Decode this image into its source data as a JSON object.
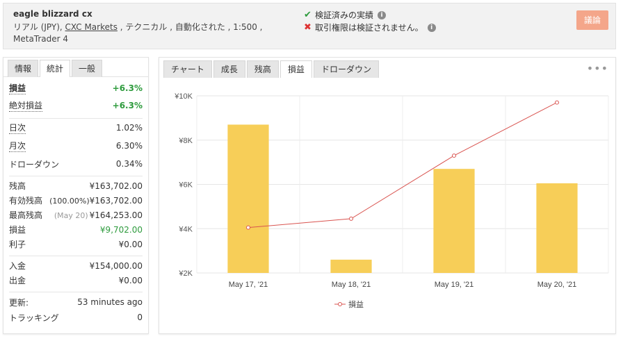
{
  "header": {
    "account_name": "eagle blizzard cx",
    "desc_prefix": "リアル (JPY), ",
    "broker": "CXC Markets",
    "desc_suffix": " , テクニカル , 自動化された , 1:500 , MetaTrader 4",
    "verified_label": "検証済みの実績",
    "trading_label": "取引権限は検証されません。",
    "discuss_button": "議論"
  },
  "left": {
    "tabs": [
      "情報",
      "統計",
      "一般"
    ],
    "active_tab": 1,
    "stats": {
      "gain_label": "損益",
      "gain_value": "+6.3%",
      "abs_gain_label": "絶対損益",
      "abs_gain_value": "+6.3%",
      "daily_label": "日次",
      "daily_value": "1.02%",
      "monthly_label": "月次",
      "monthly_value": "6.30%",
      "drawdown_label": "ドローダウン",
      "drawdown_value": "0.34%",
      "balance_label": "残高",
      "balance_value": "¥163,702.00",
      "equity_label": "有効残高",
      "equity_pct": "(100.00%)",
      "equity_value": "¥163,702.00",
      "highest_label": "最高残高",
      "highest_date": "(May 20)",
      "highest_value": "¥164,253.00",
      "profit_label": "損益",
      "profit_value": "¥9,702.00",
      "interest_label": "利子",
      "interest_value": "¥0.00",
      "deposits_label": "入金",
      "deposits_value": "¥154,000.00",
      "withdrawals_label": "出金",
      "withdrawals_value": "¥0.00",
      "updated_label": "更新:",
      "updated_value": "53 minutes ago",
      "tracking_label": "トラッキング",
      "tracking_value": "0"
    }
  },
  "right": {
    "tabs": [
      "チャート",
      "成長",
      "残高",
      "損益",
      "ドローダウン"
    ],
    "active_tab": 3,
    "more_icon": "•••"
  },
  "colors": {
    "bar": "#f7ce58",
    "line": "#d9534f",
    "green": "#2e9b3d",
    "discuss": "#f4a68a"
  },
  "chart_data": {
    "type": "bar",
    "categories": [
      "May 17, '21",
      "May 18, '21",
      "May 19, '21",
      "May 20, '21"
    ],
    "yticks": [
      "¥2K",
      "¥4K",
      "¥6K",
      "¥8K",
      "¥10K"
    ],
    "ylim": [
      2000,
      10000
    ],
    "series": [
      {
        "type": "bar",
        "values": [
          8700,
          2600,
          6700,
          6050
        ]
      },
      {
        "name": "損益",
        "type": "line",
        "values": [
          4050,
          4450,
          7300,
          9700
        ]
      }
    ],
    "legend": "bottom"
  }
}
